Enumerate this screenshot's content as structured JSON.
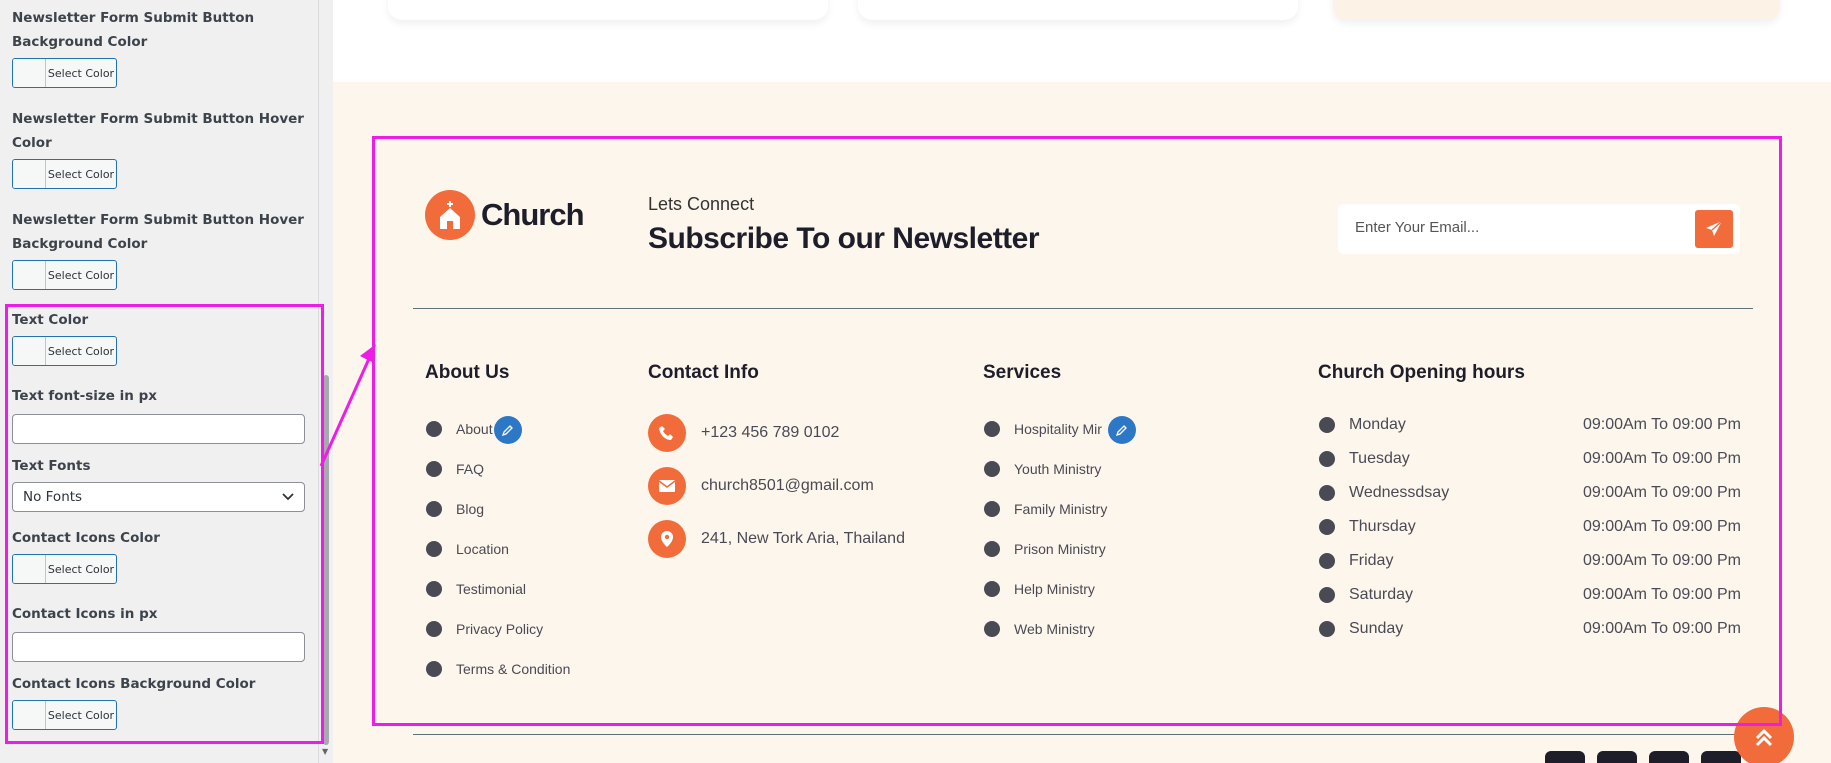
{
  "sidebar": {
    "fields": [
      {
        "label": "Newsletter Form Submit Button Background Color",
        "type": "color",
        "button": "Select Color"
      },
      {
        "label": "Newsletter Form Submit Button Hover Color",
        "type": "color",
        "button": "Select Color"
      },
      {
        "label": "Newsletter Form Submit Button Hover Background Color",
        "type": "color",
        "button": "Select Color"
      },
      {
        "label": "Text Color",
        "type": "color",
        "button": "Select Color"
      },
      {
        "label": "Text font-size in px",
        "type": "text",
        "value": ""
      },
      {
        "label": "Text Fonts",
        "type": "select",
        "value": "No Fonts"
      },
      {
        "label": "Contact Icons Color",
        "type": "color",
        "button": "Select Color"
      },
      {
        "label": "Contact Icons in px",
        "type": "text",
        "value": ""
      },
      {
        "label": "Contact Icons Background Color",
        "type": "color",
        "button": "Select Color"
      }
    ]
  },
  "footer": {
    "logo_text": "Church",
    "newsletter": {
      "subtitle": "Lets Connect",
      "title": "Subscribe To our Newsletter",
      "email_placeholder": "Enter Your Email..."
    },
    "about": {
      "title": "About Us",
      "links": [
        "About",
        "FAQ",
        "Blog",
        "Location",
        "Testimonial",
        "Privacy Policy",
        "Terms & Condition"
      ]
    },
    "contact": {
      "title": "Contact Info",
      "phone": "+123 456 789 0102",
      "email": "church8501@gmail.com",
      "address": "241, New Tork Aria, Thailand"
    },
    "services": {
      "title": "Services",
      "links": [
        "Hospitality Mir",
        "Youth Ministry",
        "Family Ministry",
        "Prison Ministry",
        "Help Ministry",
        "Web Ministry"
      ]
    },
    "hours": {
      "title": "Church Opening hours",
      "rows": [
        {
          "day": "Monday",
          "time": "09:00Am To 09:00 Pm"
        },
        {
          "day": "Tuesday",
          "time": "09:00Am To 09:00 Pm"
        },
        {
          "day": "Wednessdsay",
          "time": "09:00Am To 09:00 Pm"
        },
        {
          "day": "Thursday",
          "time": "09:00Am To 09:00 Pm"
        },
        {
          "day": "Friday",
          "time": "09:00Am To 09:00 Pm"
        },
        {
          "day": "Saturday",
          "time": "09:00Am To 09:00 Pm"
        },
        {
          "day": "Sunday",
          "time": "09:00Am To 09:00 Pm"
        }
      ]
    }
  },
  "colors": {
    "accent": "#f26b3a",
    "highlight": "#ee1ce7",
    "footer_bg": "#fdf6ec",
    "edit": "#2d78c6"
  }
}
